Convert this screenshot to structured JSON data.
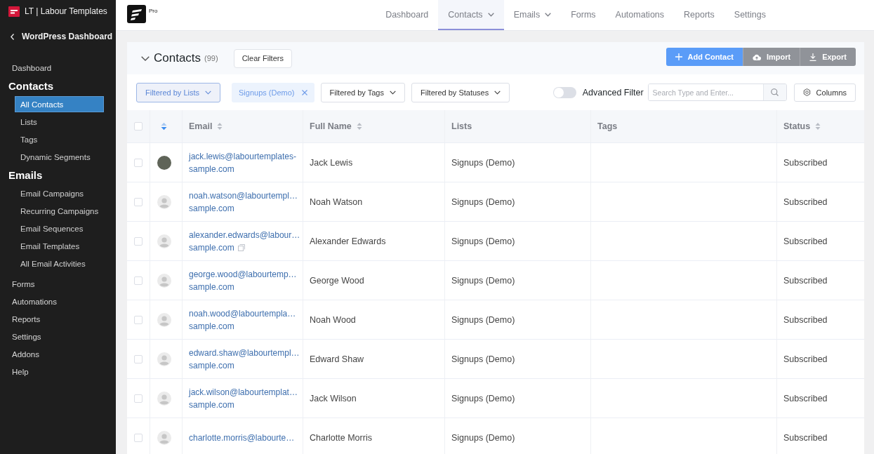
{
  "sidebar": {
    "site_title": "LT | Labour Templates",
    "back_link": "WordPress Dashboard",
    "items": [
      {
        "label": "Dashboard",
        "expanded": false
      },
      {
        "label": "Contacts",
        "expanded": true,
        "children": [
          {
            "label": "All Contacts",
            "selected": true
          },
          {
            "label": "Lists",
            "selected": false
          },
          {
            "label": "Tags",
            "selected": false
          },
          {
            "label": "Dynamic Segments",
            "selected": false
          }
        ]
      },
      {
        "label": "Emails",
        "expanded": true,
        "children": [
          {
            "label": "Email Campaigns",
            "selected": false
          },
          {
            "label": "Recurring Campaigns",
            "selected": false
          },
          {
            "label": "Email Sequences",
            "selected": false
          },
          {
            "label": "Email Templates",
            "selected": false
          },
          {
            "label": "All Email Activities",
            "selected": false
          }
        ]
      },
      {
        "label": "Forms",
        "expanded": false
      },
      {
        "label": "Automations",
        "expanded": false
      },
      {
        "label": "Reports",
        "expanded": false
      },
      {
        "label": "Settings",
        "expanded": false
      },
      {
        "label": "Addons",
        "expanded": false
      },
      {
        "label": "Help",
        "expanded": false
      }
    ]
  },
  "top_bar": {
    "badge": "Pro",
    "nav": [
      {
        "label": "Dashboard",
        "selected": false,
        "dropdown": false
      },
      {
        "label": "Contacts",
        "selected": true,
        "dropdown": true
      },
      {
        "label": "Emails",
        "selected": false,
        "dropdown": true
      },
      {
        "label": "Forms",
        "selected": false,
        "dropdown": false
      },
      {
        "label": "Automations",
        "selected": false,
        "dropdown": false
      },
      {
        "label": "Reports",
        "selected": false,
        "dropdown": false
      },
      {
        "label": "Settings",
        "selected": false,
        "dropdown": false
      }
    ]
  },
  "contacts_panel": {
    "title": "Contacts",
    "count": "(99)",
    "clear_filters": "Clear Filters",
    "actions": [
      {
        "label": "Add Contact",
        "kind": "primary"
      },
      {
        "label": "Import",
        "kind": "secondary"
      },
      {
        "label": "Export",
        "kind": "secondary"
      }
    ],
    "filters": [
      {
        "label": "Filtered by Lists",
        "active": true,
        "chips": [
          "Signups (Demo)"
        ]
      },
      {
        "label": "Filtered by Tags",
        "active": false
      },
      {
        "label": "Filtered by Statuses",
        "active": false
      }
    ],
    "advanced_filter": {
      "label": "Advanced Filter",
      "on": false
    },
    "search": {
      "placeholder": "Search Type and Enter..."
    },
    "columns_button": "Columns"
  },
  "table": {
    "all_checked": false,
    "sort_descending": true,
    "columns": [
      {
        "label": "Email",
        "sortable": true
      },
      {
        "label": "Full Name",
        "sortable": true
      },
      {
        "label": "Lists",
        "sortable": false
      },
      {
        "label": "Tags",
        "sortable": false
      },
      {
        "label": "Status",
        "sortable": true
      }
    ],
    "rows": [
      {
        "checked": false,
        "has_photo": true,
        "email_lines": [
          "jack.lewis@labourtemplates-",
          "sample.com"
        ],
        "hovered": false,
        "full_name": "Jack Lewis",
        "lists": "Signups (Demo)",
        "status": "Subscribed"
      },
      {
        "checked": false,
        "has_photo": false,
        "email_lines": [
          "noah.watson@labourtempl…",
          "sample.com"
        ],
        "hovered": false,
        "full_name": "Noah Watson",
        "lists": "Signups (Demo)",
        "status": "Subscribed"
      },
      {
        "checked": false,
        "has_photo": false,
        "email_lines": [
          "alexander.edwards@labour…",
          "sample.com"
        ],
        "hovered": true,
        "full_name": "Alexander Edwards",
        "lists": "Signups (Demo)",
        "status": "Subscribed"
      },
      {
        "checked": false,
        "has_photo": false,
        "email_lines": [
          "george.wood@labourtemp…",
          "sample.com"
        ],
        "hovered": false,
        "full_name": "George Wood",
        "lists": "Signups (Demo)",
        "status": "Subscribed"
      },
      {
        "checked": false,
        "has_photo": false,
        "email_lines": [
          "noah.wood@labourtempla…",
          "sample.com"
        ],
        "hovered": false,
        "full_name": "Noah Wood",
        "lists": "Signups (Demo)",
        "status": "Subscribed"
      },
      {
        "checked": false,
        "has_photo": false,
        "email_lines": [
          "edward.shaw@labourtempl…",
          "sample.com"
        ],
        "hovered": false,
        "full_name": "Edward Shaw",
        "lists": "Signups (Demo)",
        "status": "Subscribed"
      },
      {
        "checked": false,
        "has_photo": false,
        "email_lines": [
          "jack.wilson@labourtemplat…",
          "sample.com"
        ],
        "hovered": false,
        "full_name": "Jack Wilson",
        "lists": "Signups (Demo)",
        "status": "Subscribed"
      },
      {
        "checked": false,
        "has_photo": false,
        "email_lines": [
          "charlotte.morris@labourte…"
        ],
        "hovered": false,
        "full_name": "Charlotte Morris",
        "lists": "Signups (Demo)",
        "status": "Subscribed"
      }
    ]
  }
}
